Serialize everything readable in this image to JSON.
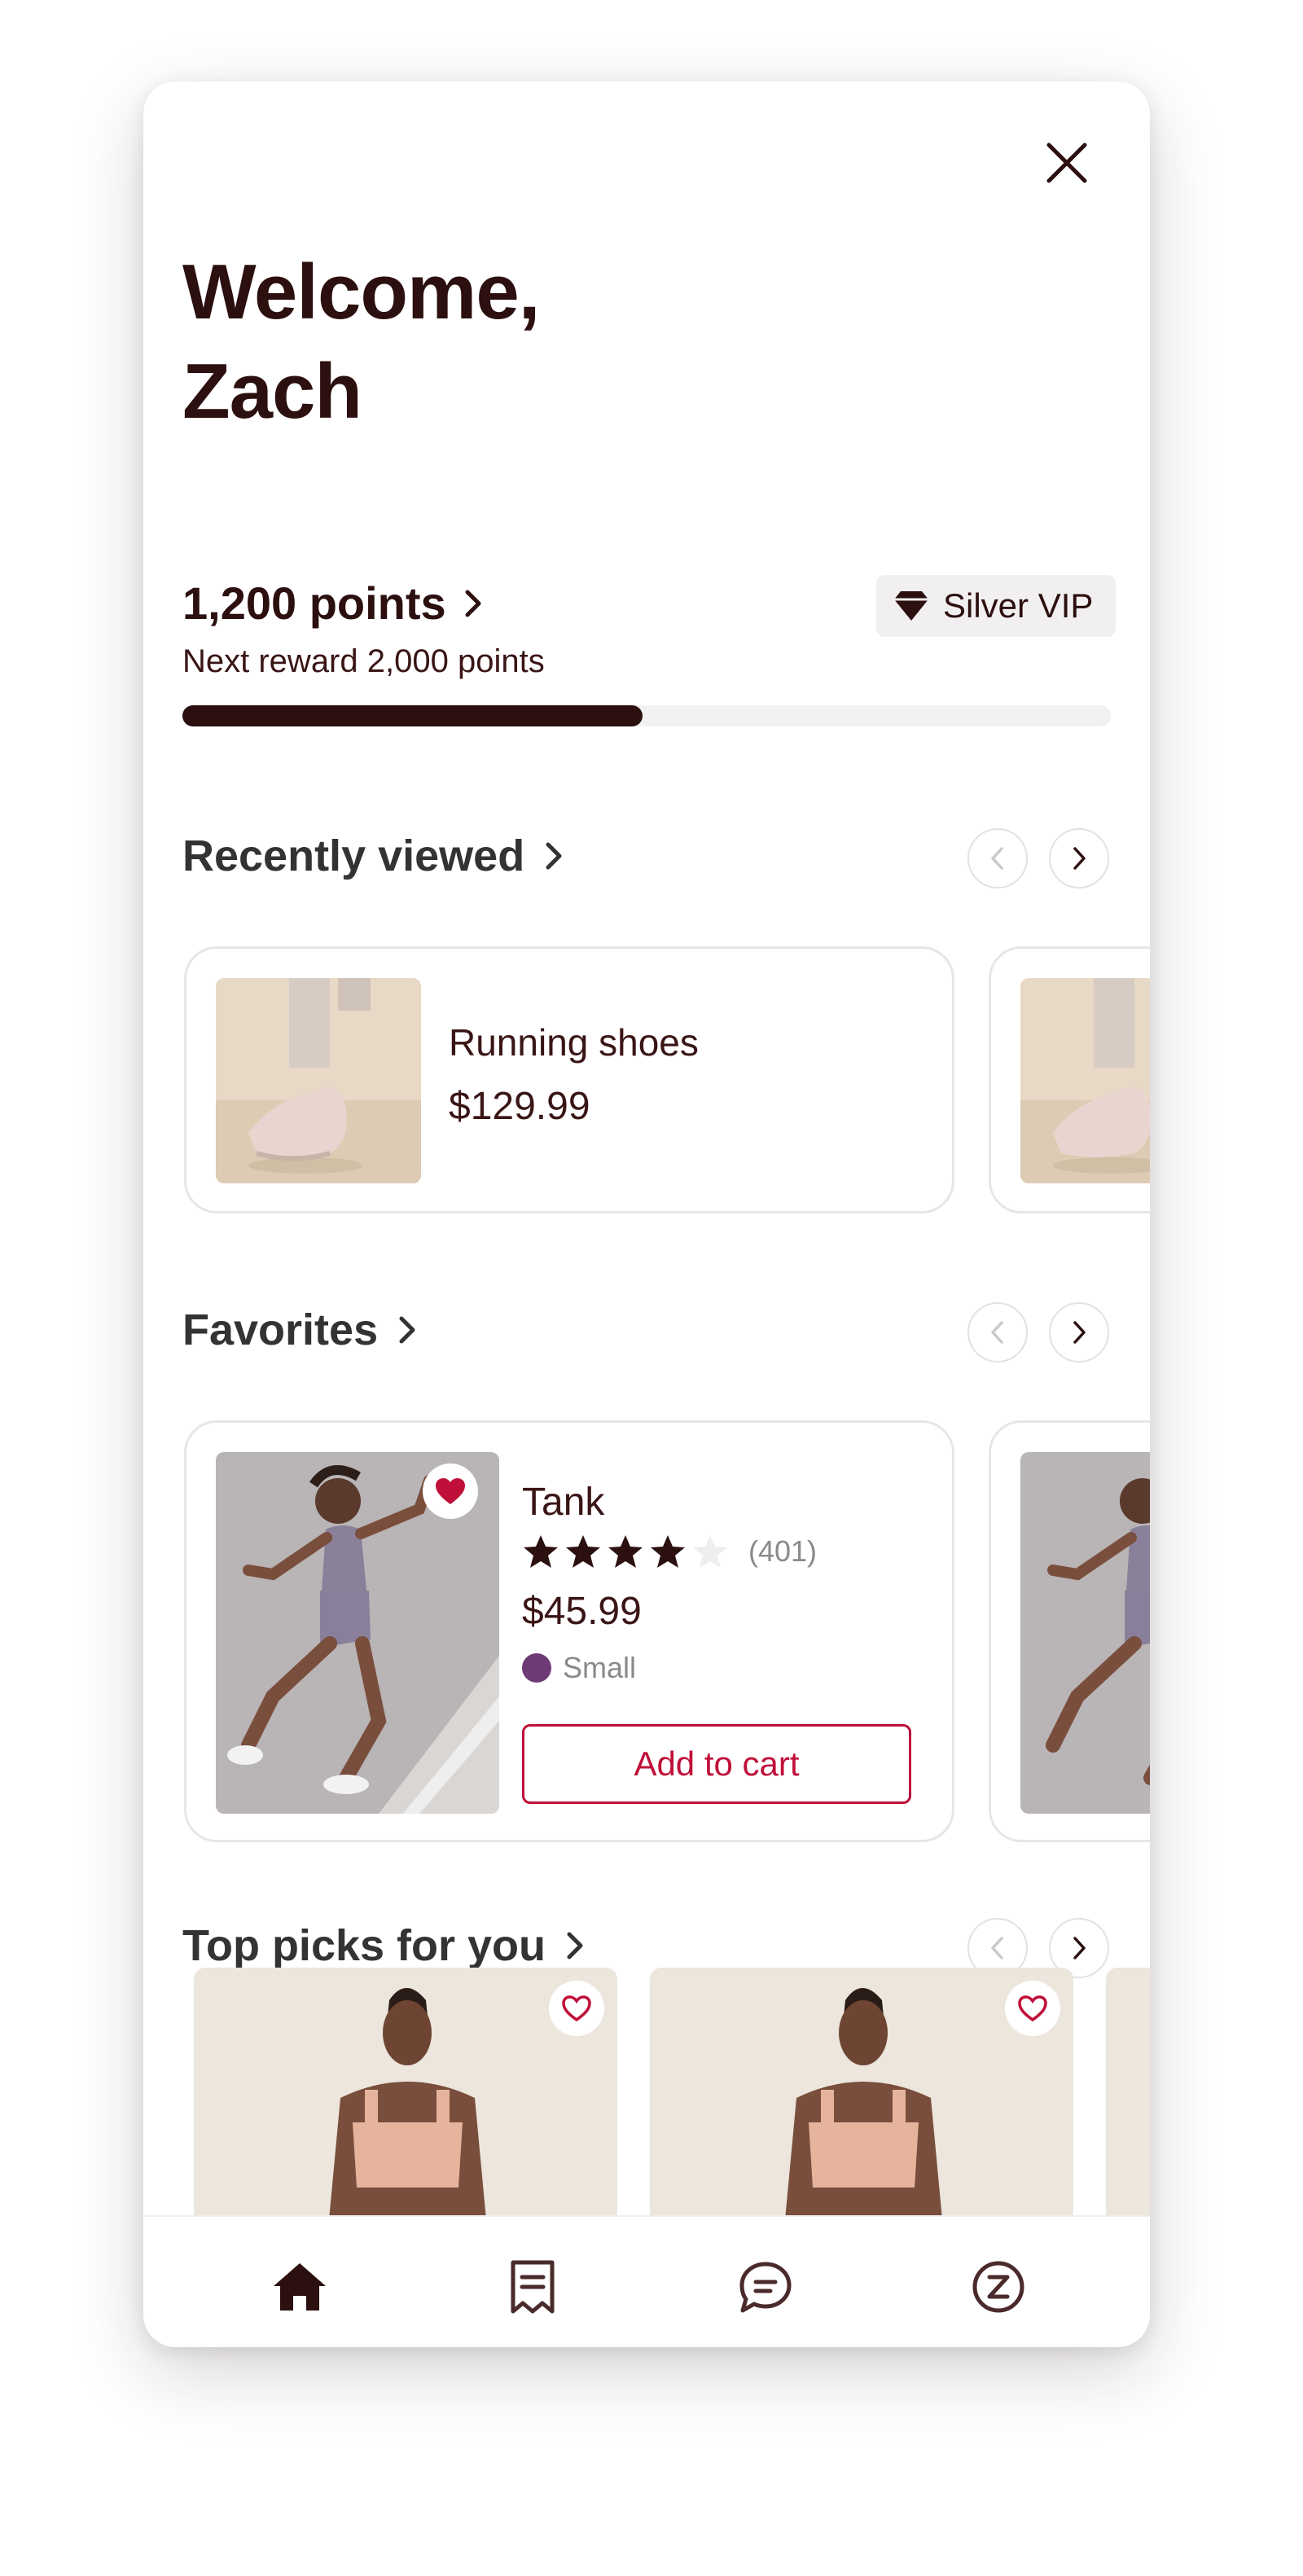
{
  "header": {
    "close_icon": "close-icon",
    "welcome_line1": "Welcome,",
    "welcome_line2": "Zach"
  },
  "rewards": {
    "points": "1,200 points",
    "next_reward": "Next reward 2,000 points",
    "progress_fraction": 0.6,
    "tier_label": "Silver VIP",
    "tier_icon": "diamond-icon"
  },
  "recently_viewed": {
    "title": "Recently viewed",
    "items": [
      {
        "name": "Running shoes",
        "price": "$129.99"
      }
    ]
  },
  "favorites": {
    "title": "Favorites",
    "items": [
      {
        "name": "Tank",
        "rating": 4,
        "rating_max": 5,
        "review_count": "(401)",
        "price": "$45.99",
        "size": "Small",
        "color": "#6e3a75",
        "cta": "Add to cart",
        "favorited": true
      }
    ]
  },
  "top_picks": {
    "title": "Top picks for you"
  },
  "tabbar": {
    "items": [
      {
        "icon": "home-icon",
        "active": true
      },
      {
        "icon": "receipt-icon",
        "active": false
      },
      {
        "icon": "chat-icon",
        "active": false
      },
      {
        "icon": "rewards-z-icon",
        "active": false
      }
    ]
  },
  "colors": {
    "brand_dark": "#2c0f0f",
    "accent_red": "#c0103a",
    "swatch_purple": "#6e3a75"
  }
}
